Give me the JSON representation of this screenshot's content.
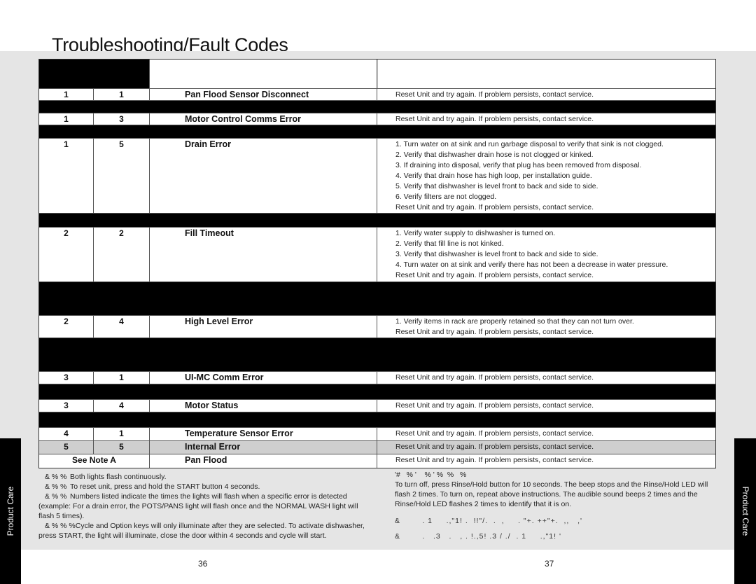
{
  "title": "Troubleshooting/Fault Codes",
  "table": {
    "rows": [
      {
        "type": "header"
      },
      {
        "type": "fault",
        "a": "1",
        "b": "1",
        "fault": "Pan Flood Sensor Disconnect",
        "actions": [
          "Reset Unit and try again. If problem persists, contact service."
        ],
        "h": 17
      },
      {
        "type": "black",
        "h": 18
      },
      {
        "type": "fault",
        "a": "1",
        "b": "3",
        "fault": "Motor Control Comms Error",
        "actions": [
          "Reset Unit and try again. If problem persists, contact service."
        ],
        "h": 17
      },
      {
        "type": "black",
        "h": 19
      },
      {
        "type": "fault",
        "a": "1",
        "b": "5",
        "fault": "Drain Error",
        "actions": [
          "1. Turn water on at sink and run garbage disposal to verify that sink is not clogged.",
          "2. Verify that dishwasher drain hose is not clogged or kinked.",
          "3. If draining into disposal, verify that plug has been removed from disposal.",
          "4. Verify that drain hose has high loop, per installation guide.",
          "5. Verify that dishwasher is level front to back and side to side.",
          "6. Verify filters are not clogged.",
          "Reset Unit and try again. If problem persists, contact service."
        ],
        "h": 107
      },
      {
        "type": "black",
        "h": 20
      },
      {
        "type": "fault",
        "a": "2",
        "b": "2",
        "fault": "Fill Timeout",
        "actions": [
          "1. Verify water supply to dishwasher is turned on.",
          "2. Verify that fill line is not kinked.",
          "3. Verify that dishwasher is level front to back and side to side.",
          "4. Turn water on at sink and verify there has not been a decrease in water pressure.",
          "Reset Unit and try again. If problem persists, contact service."
        ],
        "h": 78
      },
      {
        "type": "black",
        "h": 48
      },
      {
        "type": "fault",
        "a": "2",
        "b": "4",
        "fault": "High Level Error",
        "actions": [
          "1. Verify items in rack are properly retained so that they can not turn over.",
          "Reset Unit and try again. If problem persists, contact service."
        ],
        "h": 32
      },
      {
        "type": "black",
        "h": 48
      },
      {
        "type": "fault",
        "a": "3",
        "b": "1",
        "fault": "UI-MC Comm Error",
        "actions": [
          "Reset Unit and try again. If problem persists, contact service."
        ],
        "h": 18
      },
      {
        "type": "black",
        "h": 22
      },
      {
        "type": "fault",
        "a": "3",
        "b": "4",
        "fault": "Motor Status",
        "actions": [
          "Reset Unit and try again. If problem persists, contact service."
        ],
        "h": 18
      },
      {
        "type": "black",
        "h": 22
      },
      {
        "type": "fault",
        "a": "4",
        "b": "1",
        "fault": "Temperature Sensor Error",
        "actions": [
          "Reset Unit and try again. If problem persists, contact service."
        ],
        "h": 19
      },
      {
        "type": "fault",
        "a": "5",
        "b": "5",
        "fault": "Internal Error",
        "actions": [
          "Reset Unit and try again. If problem persists, contact service."
        ],
        "h": 19,
        "highlight": true
      },
      {
        "type": "fault",
        "span": "See Note A",
        "fault": "Pan Flood",
        "actions": [
          "Reset Unit and try again. If problem persists, contact service."
        ],
        "h": 19
      }
    ]
  },
  "notes_left": [
    {
      "glyph": "& % %",
      "text": "Both lights flash continuously."
    },
    {
      "glyph": "& % %",
      "text": "To reset unit, press and hold the START button 4 seconds."
    },
    {
      "glyph": "& % %",
      "text": "Numbers listed indicate the times the lights will flash when a specific error is detected (example: For a drain error, the POTS/PANS light will flash once and the NORMAL WASH light will flash 5 times)."
    },
    {
      "glyph": "& % % %",
      "text": "Cycle and Option keys will only illuminate after they are selected. To activate dishwasher, press START, the light will illuminate, close the door within 4 seconds and cycle will start."
    }
  ],
  "notes_right": {
    "heading": "'#   % '    % ' %  %   %",
    "paragraph": "To turn off, press Rinse/Hold button for 10 seconds. The beep stops and the Rinse/Hold LED will flash 2 times. To turn on, repeat above instructions. The audible sound beeps 2 times and the Rinse/Hold LED flashes 2 times to identify that it is on.",
    "garbled_lines": [
      "&        . 1     .,\"1! .  !!\"/.  .  ,     . \"+. ++\"+.  ,,   ,'",
      "&        .   .3   .   , . !.,5! .3 / ./  . 1     .,\"1! '"
    ]
  },
  "side_tab_label": "Product Care",
  "page_numbers": {
    "left": "36",
    "right": "37"
  }
}
